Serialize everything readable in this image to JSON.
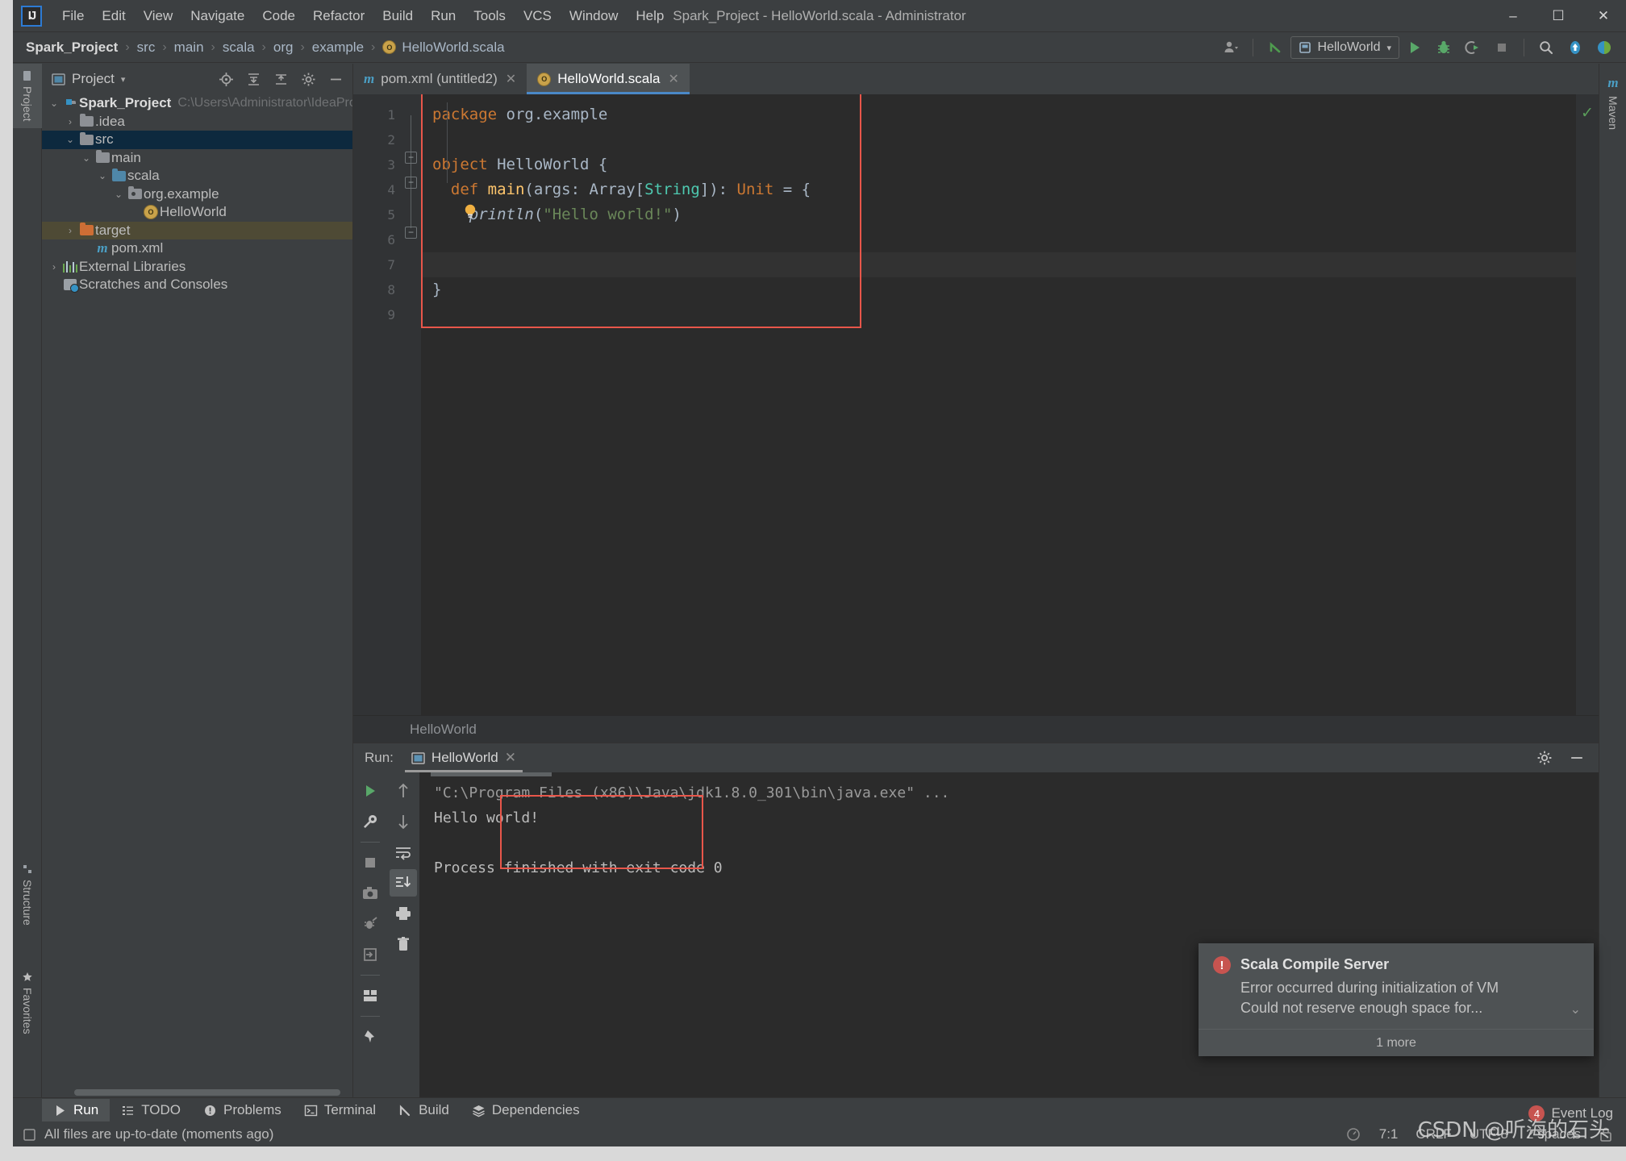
{
  "window": {
    "title": "Spark_Project - HelloWorld.scala - Administrator",
    "minimize": "–",
    "maximize": "☐",
    "close": "✕"
  },
  "menu": [
    "File",
    "Edit",
    "View",
    "Navigate",
    "Code",
    "Refactor",
    "Build",
    "Run",
    "Tools",
    "VCS",
    "Window",
    "Help"
  ],
  "breadcrumb": {
    "items": [
      "Spark_Project",
      "src",
      "main",
      "scala",
      "org",
      "example",
      "HelloWorld.scala"
    ],
    "separator": "›"
  },
  "toolbar": {
    "run_config": "HelloWorld",
    "caret": "▾",
    "icons": [
      "user-icon",
      "vcs-update-icon",
      "run-icon",
      "debug-icon",
      "run-coverage-icon",
      "stop-icon",
      "search-icon",
      "update-icon",
      "ide-icon"
    ]
  },
  "left_strip": {
    "tabs": [
      "Project",
      "Structure",
      "Favorites"
    ]
  },
  "right_strip": {
    "tabs": [
      "Maven"
    ]
  },
  "project_pane": {
    "header": "Project",
    "header_caret": "▾",
    "tree": [
      {
        "label": "Spark_Project",
        "path": "C:\\Users\\Administrator\\IdeaProjects\\",
        "icon": "module-folder",
        "arrow": "⌄",
        "depth": 0,
        "bold": true,
        "state": "none"
      },
      {
        "label": ".idea",
        "path": "",
        "icon": "folder-grey",
        "arrow": "›",
        "depth": 1,
        "bold": false,
        "state": "none"
      },
      {
        "label": "src",
        "path": "",
        "icon": "folder-grey",
        "arrow": "⌄",
        "depth": 1,
        "bold": false,
        "state": "selected-blue"
      },
      {
        "label": "main",
        "path": "",
        "icon": "folder-grey",
        "arrow": "⌄",
        "depth": 2,
        "bold": false,
        "state": "none"
      },
      {
        "label": "scala",
        "path": "",
        "icon": "folder-blue",
        "arrow": "⌄",
        "depth": 3,
        "bold": false,
        "state": "none"
      },
      {
        "label": "org.example",
        "path": "",
        "icon": "folder-package",
        "arrow": "⌄",
        "depth": 4,
        "bold": false,
        "state": "none"
      },
      {
        "label": "HelloWorld",
        "path": "",
        "icon": "scala-object",
        "arrow": "",
        "depth": 5,
        "bold": false,
        "state": "none"
      },
      {
        "label": "target",
        "path": "",
        "icon": "folder-orange",
        "arrow": "›",
        "depth": 1,
        "bold": false,
        "state": "selected-olive"
      },
      {
        "label": "pom.xml",
        "path": "",
        "icon": "maven-file",
        "arrow": "",
        "depth": 2,
        "bold": false,
        "state": "none"
      },
      {
        "label": "External Libraries",
        "path": "",
        "icon": "libraries-icon",
        "arrow": "›",
        "depth": 0,
        "bold": false,
        "state": "none"
      },
      {
        "label": "Scratches and Consoles",
        "path": "",
        "icon": "scratches-icon",
        "arrow": "",
        "depth": 0,
        "bold": false,
        "state": "none"
      }
    ]
  },
  "editor": {
    "tabs": [
      {
        "label": "pom.xml (untitled2)",
        "icon": "maven-file",
        "active": false,
        "close": "✕"
      },
      {
        "label": "HelloWorld.scala",
        "icon": "scala-object",
        "active": true,
        "close": "✕"
      }
    ],
    "line_numbers": [
      "1",
      "2",
      "3",
      "4",
      "5",
      "6",
      "7",
      "8",
      "9"
    ],
    "run_markers": [
      3,
      4
    ],
    "code_lines": [
      {
        "n": 1,
        "tokens": [
          {
            "t": "package ",
            "c": "k"
          },
          {
            "t": "org.example",
            "c": "pln"
          }
        ]
      },
      {
        "n": 2,
        "tokens": []
      },
      {
        "n": 3,
        "tokens": [
          {
            "t": "object ",
            "c": "k"
          },
          {
            "t": "HelloWorld",
            "c": "pln"
          },
          {
            "t": " {",
            "c": "pln"
          }
        ]
      },
      {
        "n": 4,
        "tokens": [
          {
            "t": "  def ",
            "c": "k"
          },
          {
            "t": "main",
            "c": "dec"
          },
          {
            "t": "(args: Array[",
            "c": "pln"
          },
          {
            "t": "String",
            "c": "typ"
          },
          {
            "t": "]): ",
            "c": "pln"
          },
          {
            "t": "Unit",
            "c": "k"
          },
          {
            "t": " = {",
            "c": "pln"
          }
        ]
      },
      {
        "n": 5,
        "tokens": [
          {
            "t": "    println",
            "c": "pln it"
          },
          {
            "t": "(",
            "c": "pln"
          },
          {
            "t": "\"Hello world!\"",
            "c": "str"
          },
          {
            "t": ")",
            "c": "pln"
          }
        ]
      },
      {
        "n": 6,
        "tokens": [
          {
            "t": "  }",
            "c": "pln"
          }
        ]
      },
      {
        "n": 7,
        "tokens": []
      },
      {
        "n": 8,
        "tokens": [
          {
            "t": "}",
            "c": "pln"
          }
        ]
      },
      {
        "n": 9,
        "tokens": []
      }
    ],
    "breadcrumb": "HelloWorld",
    "inspection_status": "✓",
    "bulb_icon": "intention-bulb-icon"
  },
  "run_window": {
    "label": "Run:",
    "tab": "HelloWorld",
    "tab_close": "✕",
    "console_lines": [
      {
        "text": "\"C:\\Program Files (x86)\\Java\\jdk1.8.0_301\\bin\\java.exe\" ...",
        "kind": "cmd"
      },
      {
        "text": "Hello world!",
        "kind": "out"
      },
      {
        "text": "",
        "kind": "out"
      },
      {
        "text": "Process finished with exit code 0",
        "kind": "out"
      }
    ],
    "left_icons": [
      "rerun-icon",
      "settings-wrench-icon",
      "stop-icon",
      "camera-icon",
      "dump-threads-icon",
      "export-icon",
      "layout-icon",
      "pin-icon"
    ],
    "second_icons": [
      "up-arrow-icon",
      "down-arrow-icon",
      "soft-wrap-icon",
      "scroll-to-end-icon",
      "print-icon",
      "trash-icon"
    ],
    "header_icons": [
      "gear-icon",
      "minimize-icon"
    ]
  },
  "notification": {
    "title": "Scala Compile Server",
    "line1": "Error occurred during initialization of VM",
    "line2": "Could not reserve enough space for...",
    "more": "1 more",
    "error_glyph": "!",
    "chevron": "⌄"
  },
  "bottom_tabs": [
    {
      "label": "Run",
      "icon": "run-icon",
      "active": true
    },
    {
      "label": "TODO",
      "icon": "todo-icon",
      "active": false
    },
    {
      "label": "Problems",
      "icon": "problems-icon",
      "active": false
    },
    {
      "label": "Terminal",
      "icon": "terminal-icon",
      "active": false
    },
    {
      "label": "Build",
      "icon": "build-icon",
      "active": false
    },
    {
      "label": "Dependencies",
      "icon": "dependencies-icon",
      "active": false
    }
  ],
  "status_bar": {
    "message": "All files are up-to-date (moments ago)",
    "caret_position": "7:1",
    "line_separator": "CRLF",
    "encoding": "UTF-8",
    "indent": "2 spaces",
    "event_log": "Event Log",
    "event_count": "4",
    "watermark": "CSDN @听海的石头"
  },
  "colors": {
    "accent_blue": "#4a88c7",
    "keyword_orange": "#cc7832",
    "string_green": "#6a8759",
    "type_teal": "#4ec9b0",
    "error_red": "#c75450",
    "highlight_box": "#e8564a"
  }
}
